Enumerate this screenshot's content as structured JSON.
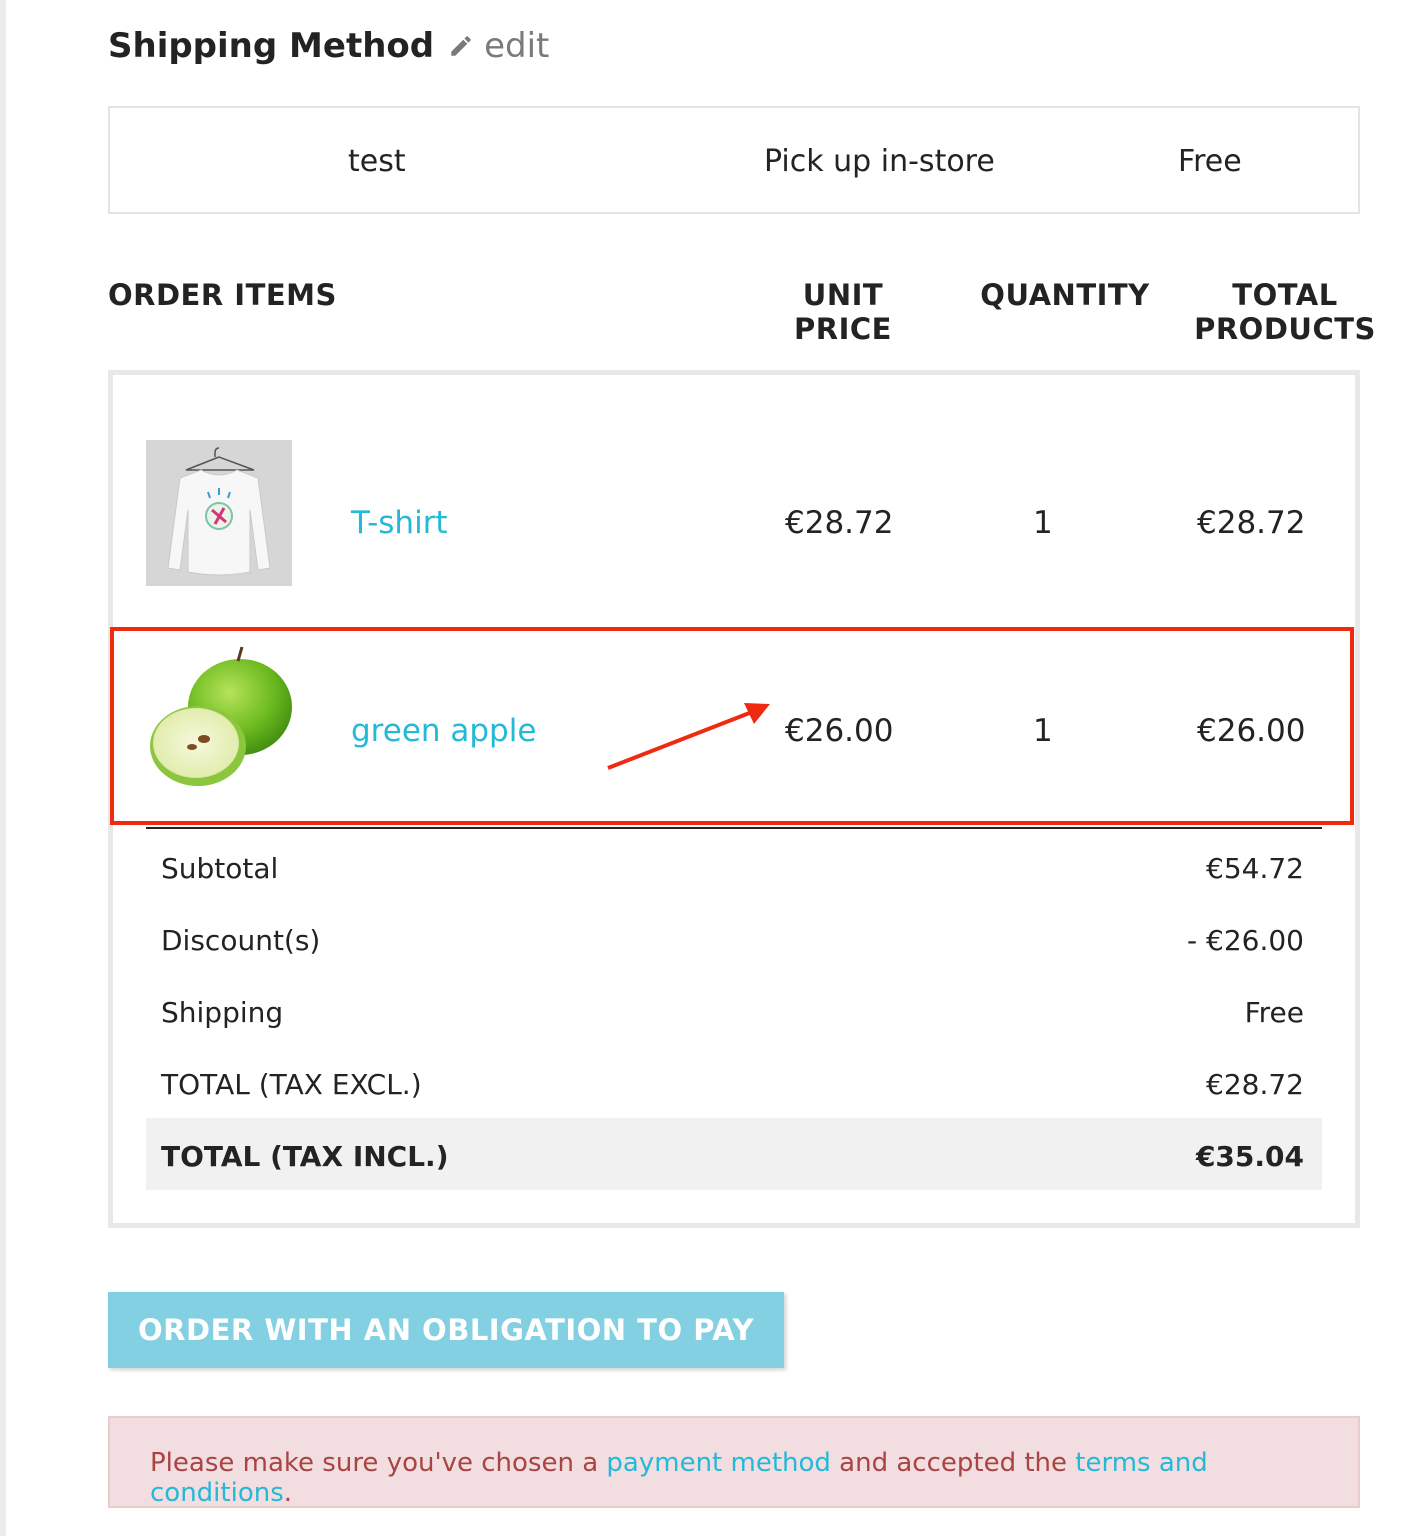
{
  "shipping_method": {
    "title": "Shipping Method",
    "edit_label": "edit",
    "carrier_name": "test",
    "delay": "Pick up in-store",
    "price": "Free"
  },
  "order_items": {
    "headers": {
      "items": "ORDER ITEMS",
      "unit_price_line1": "UNIT",
      "unit_price_line2": "PRICE",
      "quantity": "QUANTITY",
      "total_line1": "TOTAL",
      "total_line2": "PRODUCTS"
    },
    "items": [
      {
        "name": "T-shirt",
        "unit_price": "€28.72",
        "quantity": "1",
        "total": "€28.72"
      },
      {
        "name": "green apple",
        "unit_price": "€26.00",
        "quantity": "1",
        "total": "€26.00"
      }
    ]
  },
  "summary": {
    "subtotal": {
      "label": "Subtotal",
      "value": "€54.72"
    },
    "discounts": {
      "label": "Discount(s)",
      "value": "- €26.00"
    },
    "shipping": {
      "label": "Shipping",
      "value": "Free"
    },
    "total_excl": {
      "label": "TOTAL (TAX EXCL.)",
      "value": "€28.72"
    },
    "total_incl": {
      "label": "TOTAL (TAX INCL.)",
      "value": "€35.04"
    }
  },
  "order_button": {
    "label": "ORDER WITH AN OBLIGATION TO PAY"
  },
  "alert": {
    "text_before": "Please make sure you've chosen a ",
    "link_payment": "payment method",
    "text_middle": " and accepted the ",
    "link_terms": "terms and conditions",
    "text_after": "."
  },
  "colors": {
    "link": "#24b9d7",
    "button": "#84d0e3",
    "annotation": "#ee2a10",
    "alert_bg": "#f2dde0",
    "alert_text": "#a94442"
  }
}
